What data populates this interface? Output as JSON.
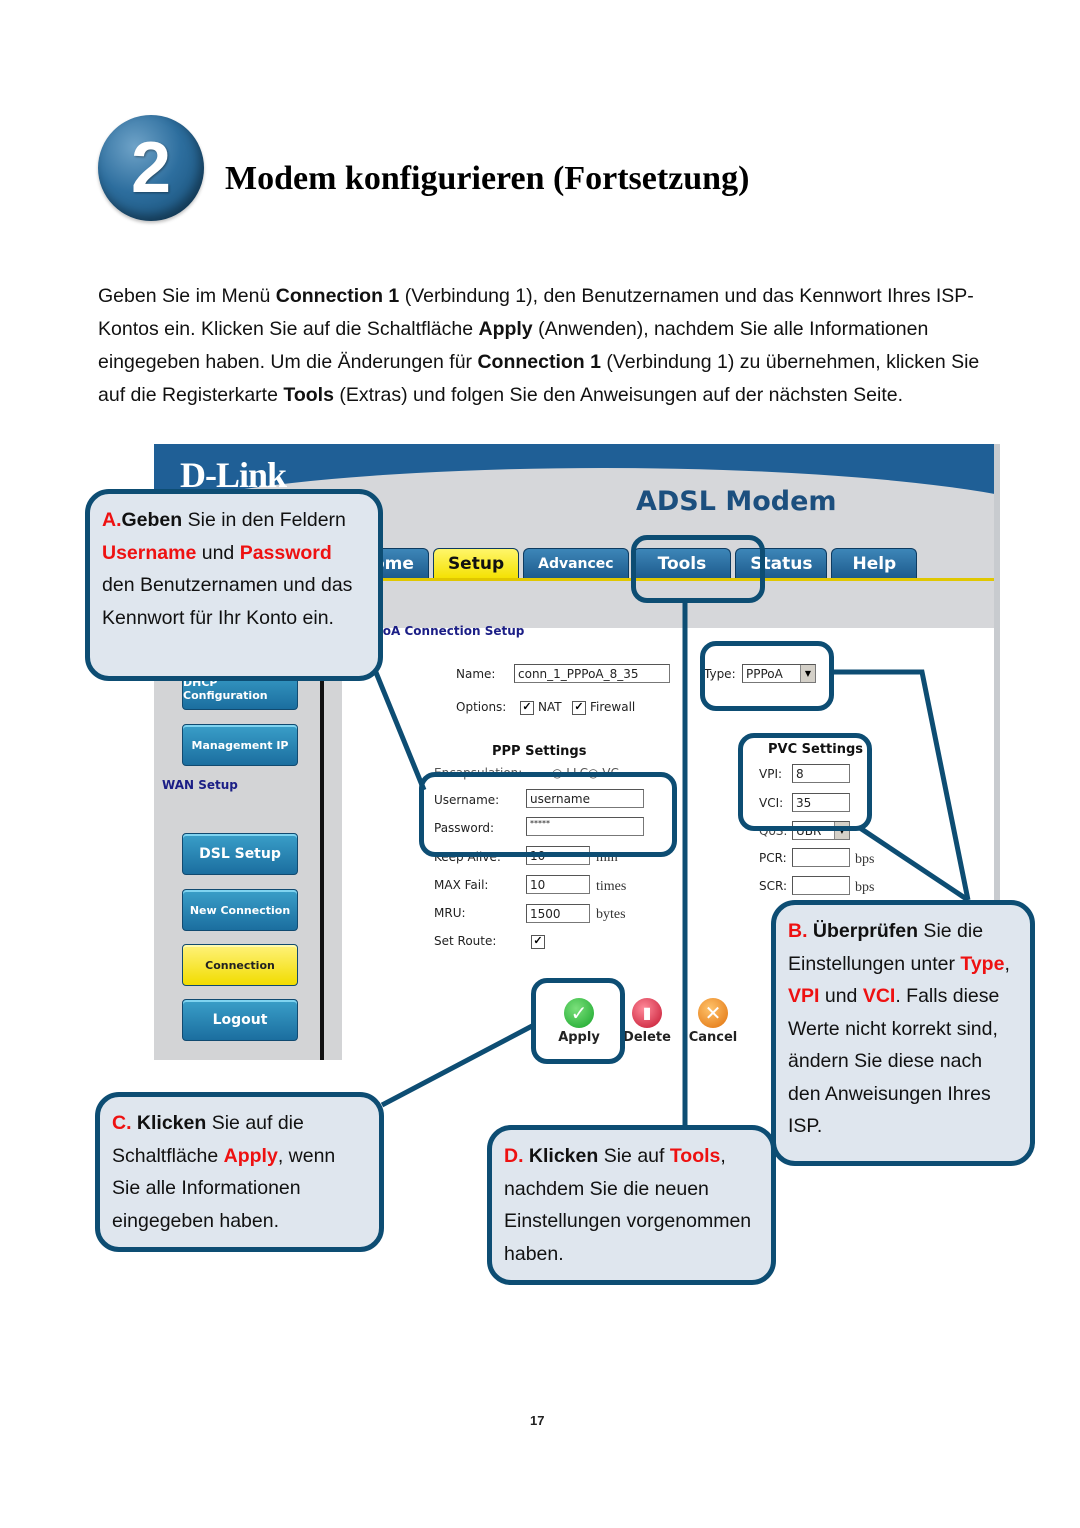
{
  "heading": {
    "step_number": "2",
    "title": "Modem konfigurieren (Fortsetzung)"
  },
  "intro": {
    "p1": "Geben Sie im Menü ",
    "b1": "Connection 1",
    "p2": " (Verbindung 1), den Benutzernamen und das Kennwort Ihres ISP-Kontos ein. Klicken Sie auf die Schaltfläche ",
    "b2": "Apply",
    "p3": " (Anwenden), nachdem Sie alle Informationen eingegeben haben. Um die Änderungen für ",
    "b3": "Connection 1",
    "p4": " (Verbindung 1) zu übernehmen, klicken Sie auf die Registerkarte ",
    "b4": "Tools",
    "p5": " (Extras) und folgen Sie den Anweisungen auf der nächsten Seite."
  },
  "router": {
    "brand": "D-Link",
    "product": "ADSL Modem",
    "tabs": [
      {
        "label": "ome"
      },
      {
        "label": "Setup"
      },
      {
        "label": "Advancec"
      },
      {
        "label": "Tools"
      },
      {
        "label": "Status"
      },
      {
        "label": "Help"
      }
    ],
    "sidebar": {
      "buttons": [
        {
          "label": "DHCP Configuration"
        },
        {
          "label": "Management IP"
        },
        {
          "label": "DSL Setup"
        },
        {
          "label": "New Connection"
        },
        {
          "label": "Connection"
        },
        {
          "label": "Logout"
        }
      ],
      "wan_setup_label": "WAN Setup"
    },
    "form": {
      "section_title": "PoA Connection Setup",
      "name_label": "Name:",
      "name_value": "conn_1_PPPoA_8_35",
      "type_label": "Type:",
      "type_value": "PPPoA",
      "options_label": "Options:",
      "nat_label": "NAT",
      "firewall_label": "Firewall",
      "ppp_settings_title": "PPP Settings",
      "encapsulation_label": "Encapsulation:",
      "encapsulation_llc": "LLC",
      "encapsulation_vc": "VC",
      "username_label": "Username:",
      "username_value": "username",
      "password_label": "Password:",
      "password_value": "*****",
      "keepalive_label": "Keep Alive:",
      "keepalive_value": "10",
      "keepalive_unit": "min",
      "maxfail_label": "MAX Fail:",
      "maxfail_value": "10",
      "maxfail_unit": "times",
      "mru_label": "MRU:",
      "mru_value": "1500",
      "mru_unit": "bytes",
      "setroute_label": "Set Route:",
      "pvc_settings_title": "PVC Settings",
      "vpi_label": "VPI:",
      "vpi_value": "8",
      "vci_label": "VCI:",
      "vci_value": "35",
      "qos_label": "QoS:",
      "qos_value": "UBR",
      "pcr_label": "PCR:",
      "pcr_unit": "bps",
      "scr_label": "SCR:",
      "scr_unit": "bps"
    },
    "actions": {
      "apply": "Apply",
      "delete": "Delete",
      "cancel": "Cancel"
    }
  },
  "callouts": {
    "a": {
      "letter": "A.",
      "verb": "Geben",
      "t1": " Sie in den Feldern ",
      "k1": "Username",
      "t2": " und ",
      "k2": "Password",
      "t3": " den Benutzernamen und das Kennwort für Ihr Konto ein."
    },
    "b": {
      "letter": "B.",
      "verb": " Überprüfen",
      "t1": " Sie die Einstellungen unter ",
      "k1": "Type",
      "t2": ", ",
      "k2": "VPI",
      "t3": " und ",
      "k3": "VCI",
      "t4": ". Falls diese Werte nicht korrekt sind, ändern Sie diese nach den Anweisungen Ihres ISP."
    },
    "c": {
      "letter": "C.",
      "verb": " Klicken",
      "t1": " Sie auf die Schaltfläche ",
      "k1": "Apply",
      "t2": ", wenn Sie alle Informationen eingegeben haben."
    },
    "d": {
      "letter": "D.",
      "verb": " Klicken",
      "t1": " Sie auf ",
      "k1": "Tools",
      "t2": ", nachdem Sie die neuen Einstellungen vorgenommen haben."
    }
  },
  "colors": {
    "callout_border": "#0d4d73",
    "callout_fill": "#dfe6ee",
    "highlight_red": "#ee1111",
    "dlink_blue": "#1f5f96",
    "active_yellow": "#f4e100"
  },
  "page_number": "17"
}
